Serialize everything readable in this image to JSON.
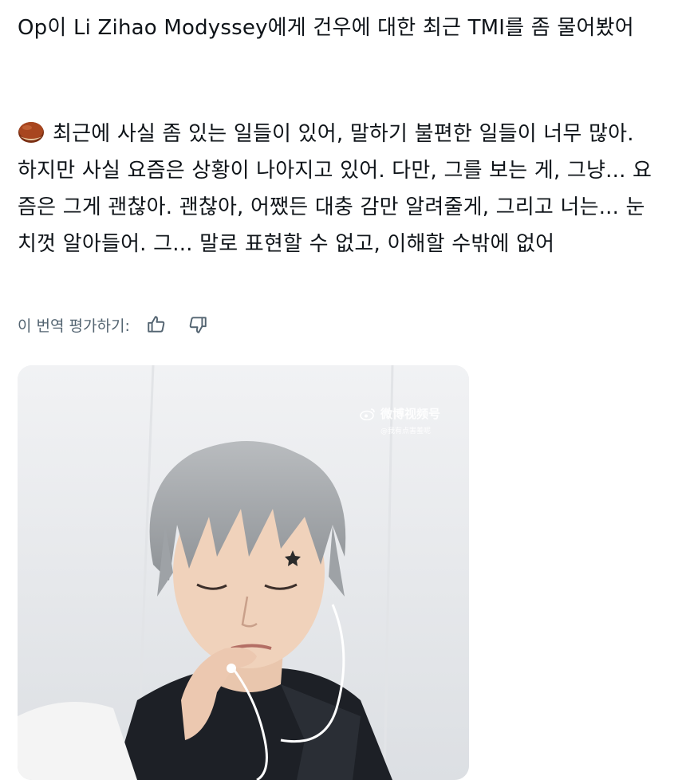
{
  "post": {
    "intro": "Op이 Li Zihao Modyssey에게 건우에 대한 최근 TMI를 좀 물어봤어",
    "emoji": "chestnut-emoji",
    "body": "최근에 사실 좀 있는 일들이 있어, 말하기 불편한 일들이 너무 많아. 하지만 사실 요즘은 상황이 나아지고 있어. 다만, 그를 보는 게, 그냥... 요즘은 그게 괜찮아. 괜찮아, 어쨌든 대충 감만 알려줄게, 그리고 너는... 눈치껏 알아들어. 그... 말로 표현할 수 없고, 이해할 수밖에 없어"
  },
  "translation_rating": {
    "label": "이 번역 평가하기:",
    "like_icon": "thumbs-up-icon",
    "dislike_icon": "thumbs-down-icon"
  },
  "media": {
    "watermark_main": "微博视频号",
    "watermark_sub": "@我有点害羞呢",
    "description_icon": "weibo-logo-icon"
  }
}
